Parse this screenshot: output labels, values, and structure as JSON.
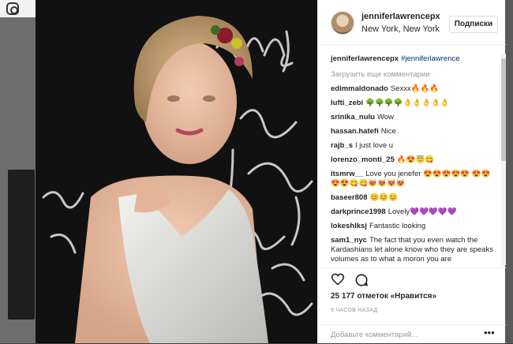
{
  "post": {
    "username": "jenniferlawrencepx",
    "location": "New York, New York",
    "follow_label": "Подписки"
  },
  "caption": {
    "username": "jenniferlawrencepx",
    "text": "#jenniferlawrence"
  },
  "load_more_label": "Загрузить еще комментарии",
  "comments": [
    {
      "user": "edimmaldonado",
      "text": "Sexxx🔥🔥🔥"
    },
    {
      "user": "lufti_zebi",
      "text": "🌳🌳🌳🌳👌👌👌👌👌"
    },
    {
      "user": "srinika_nulu",
      "text": "Wow"
    },
    {
      "user": "hassan.hatefi",
      "text": "Nice"
    },
    {
      "user": "rajb_s",
      "text": "I just love u"
    },
    {
      "user": "lorenzo_monti_25",
      "text": "🔥😍😇😋"
    },
    {
      "user": "itsmrw__",
      "text": "Love you jenefer 😍😍😍😍😍 😍😍😍😍😋😋😻😻😻😻"
    },
    {
      "user": "baseer808",
      "text": "😊😊😊"
    },
    {
      "user": "darkprince1998",
      "text": "Lovely💜💜💜💜💜"
    },
    {
      "user": "lokeshlksj",
      "text": "Fantastic looking"
    },
    {
      "user": "sam1_nyc",
      "text": "The fact that you even watch the Kardashians let alone know who they are speaks volumes as to what a moron you are"
    }
  ],
  "likes_text": "25 177 отметок «Нравится»",
  "time_text": "9 ЧАСОВ НАЗАД",
  "add_comment_placeholder": "Добавьте комментарий...",
  "more_label": "•••",
  "icons": {
    "like": "heart-outline-icon",
    "comment": "speech-bubble-icon"
  },
  "colors": {
    "text": "#262626",
    "muted": "#999999",
    "hashtag": "#003569",
    "border": "#efefef"
  }
}
